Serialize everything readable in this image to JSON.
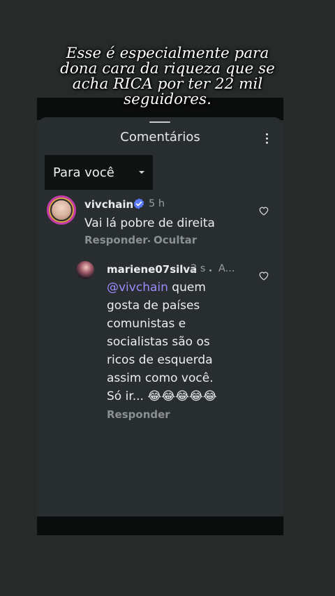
{
  "caption": {
    "lines": [
      "Esse é especialmente para",
      "dona cara da riqueza que se",
      "acha RICA por ter 22 mil",
      "seguidores."
    ]
  },
  "sheet": {
    "title": "Comentários"
  },
  "filter": {
    "label": "Para você"
  },
  "comments": [
    {
      "username": "vivchain",
      "time": "5 h",
      "text": "Vai lá pobre de direita",
      "actions": [
        "Responder",
        "Ocultar"
      ]
    },
    {
      "username": "mariene07silva",
      "time": "2 s",
      "extra": "A...",
      "mention": "@vivchain",
      "text_lines": [
        "quem",
        "gosta de países",
        "comunistas e",
        "socialistas são os",
        "ricos de esquerda",
        "assim como você.",
        "Só ir... 😂😂😂😂😂"
      ],
      "actions": [
        "Responder"
      ]
    }
  ],
  "colors": {
    "background": "#262a29",
    "sheet": "#282d2f",
    "mention": "#9a8cff",
    "verified": "#5b7cff"
  }
}
